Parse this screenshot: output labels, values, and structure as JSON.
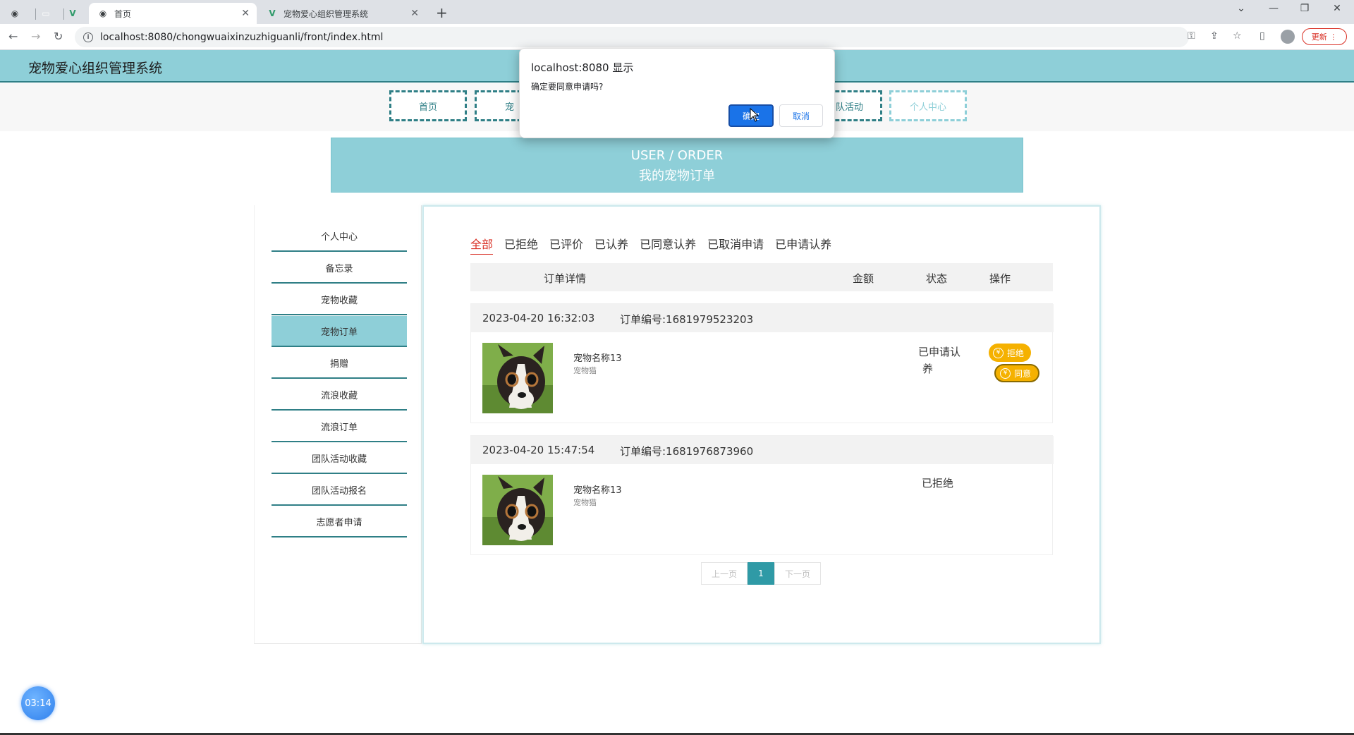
{
  "browser": {
    "tabs": [
      {
        "title": "首页",
        "active": true
      },
      {
        "title": "宠物爱心组织管理系统",
        "active": false
      }
    ],
    "url": "localhost:8080/chongwuaixinzuzhiguanli/front/index.html",
    "update_label": "更新"
  },
  "site": {
    "title": "宠物爱心组织管理系统",
    "nav": [
      "首页",
      "宠",
      "队活动",
      "个人中心"
    ]
  },
  "banner": {
    "en": "USER / ORDER",
    "cn": "我的宠物订单"
  },
  "sidebar": {
    "items": [
      "个人中心",
      "备忘录",
      "宠物收藏",
      "宠物订单",
      "捐赠",
      "流浪收藏",
      "流浪订单",
      "团队活动收藏",
      "团队活动报名",
      "志愿者申请"
    ],
    "active": "宠物订单"
  },
  "filters": {
    "tabs": [
      "全部",
      "已拒绝",
      "已评价",
      "已认养",
      "已同意认养",
      "已取消申请",
      "已申请认养"
    ],
    "active": "全部"
  },
  "table": {
    "headers": {
      "detail": "订单详情",
      "amount": "金额",
      "status": "状态",
      "action": "操作"
    }
  },
  "orders": [
    {
      "time": "2023-04-20 16:32:03",
      "order_no": "订单编号:1681979523203",
      "pet_name": "宠物名称13",
      "pet_type": "宠物猫",
      "status_line1": "已申请认",
      "status_line2": "养",
      "actions": [
        "拒绝",
        "同意"
      ]
    },
    {
      "time": "2023-04-20 15:47:54",
      "order_no": "订单编号:1681976873960",
      "pet_name": "宠物名称13",
      "pet_type": "宠物猫",
      "status_line1": "已拒绝"
    }
  ],
  "pager": {
    "prev": "上一页",
    "current": "1",
    "next": "下一页"
  },
  "dialog": {
    "title": "localhost:8080 显示",
    "message": "确定要同意申请吗?",
    "ok": "确定",
    "cancel": "取消"
  },
  "timer": "03:14",
  "colors": {
    "accent": "#8ecfd8",
    "dark_accent": "#2f7f86",
    "button_yellow": "#f5b100",
    "active_filter": "#d93025"
  }
}
